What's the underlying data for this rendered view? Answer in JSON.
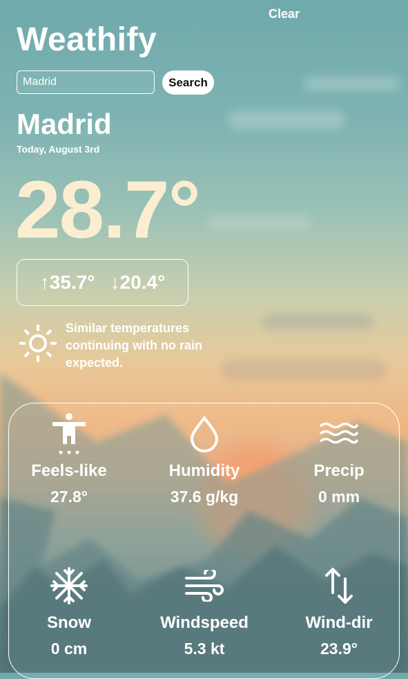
{
  "header": {
    "clear_label": "Clear",
    "app_title": "Weathify"
  },
  "search": {
    "value": "Madrid",
    "placeholder": "",
    "button_label": "Search"
  },
  "location": {
    "city": "Madrid",
    "date": "Today, August 3rd"
  },
  "current": {
    "temperature": "28.7°",
    "high": "↑35.7°",
    "low": "↓20.4°",
    "condition_icon": "sun-icon",
    "summary": "Similar temperatures continuing with no rain expected."
  },
  "metrics": [
    {
      "label": "Feels-like",
      "value": "27.8°",
      "icon": "person-icon"
    },
    {
      "label": "Humidity",
      "value": "37.6 g/kg",
      "icon": "droplet-icon"
    },
    {
      "label": "Precip",
      "value": "0 mm",
      "icon": "waves-icon"
    },
    {
      "label": "Snow",
      "value": "0 cm",
      "icon": "snowflake-icon"
    },
    {
      "label": "Windspeed",
      "value": "5.3 kt",
      "icon": "wind-icon"
    },
    {
      "label": "Wind-dir",
      "value": "23.9°",
      "icon": "arrows-updown-icon"
    }
  ],
  "colors": {
    "temperature": "#fbeed0",
    "sun_glow": "#f29f6d",
    "sky_top": "#6fa9ac"
  }
}
